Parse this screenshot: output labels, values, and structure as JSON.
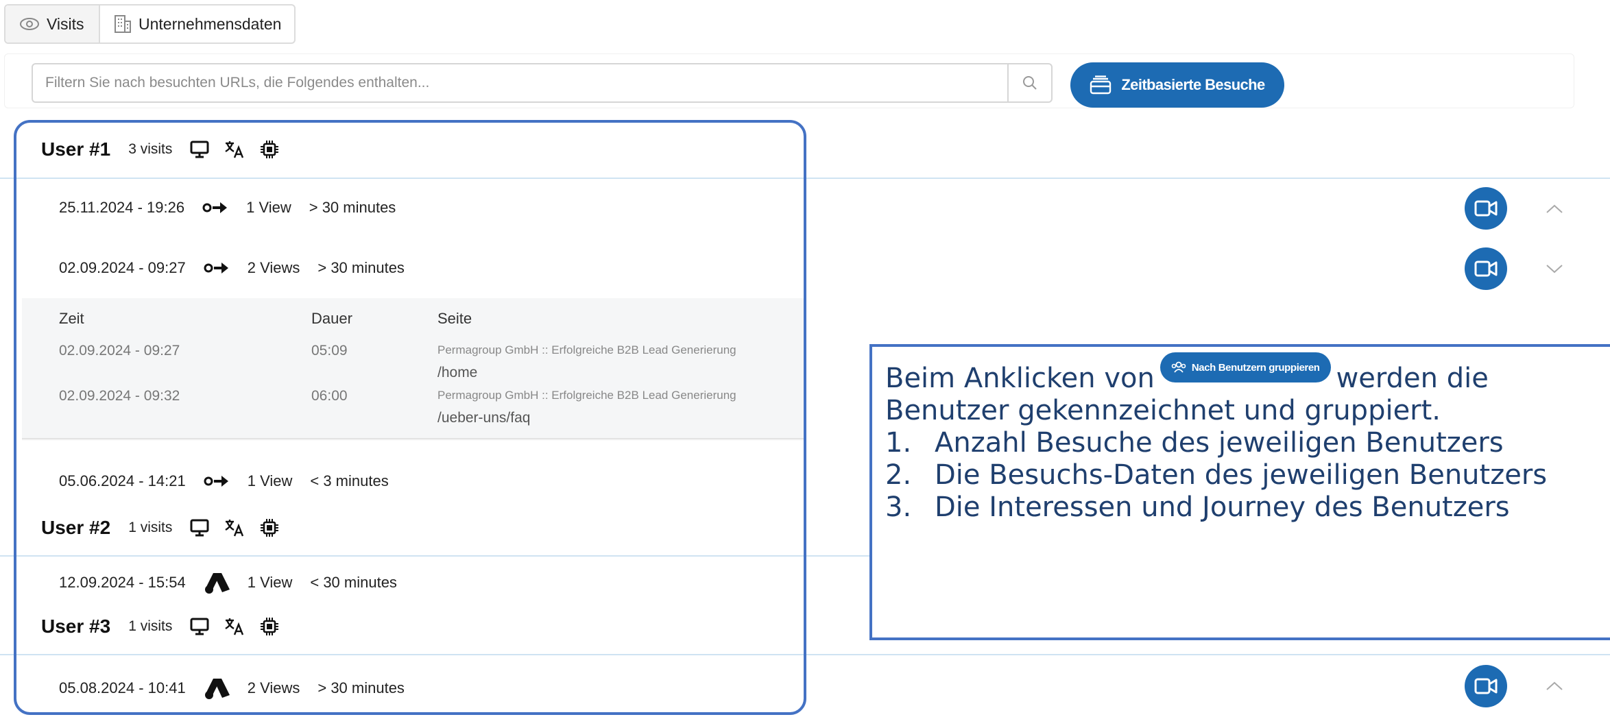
{
  "tabs": {
    "visits_label": "Visits",
    "company_label": "Unternehmensdaten"
  },
  "filter": {
    "placeholder": "Filtern Sie nach besuchten URLs, die Folgendes enthalten...",
    "time_based_label": "Zeitbasierte Besuche"
  },
  "users": [
    {
      "title": "User #1",
      "visits": "3 visits",
      "header_icons": [
        "monitor-icon",
        "translate-icon",
        "chip-icon"
      ],
      "sessions": [
        {
          "date": "25.11.2024 - 19:26",
          "source_icon": "direct-entry-icon",
          "views": "1 View",
          "duration": "> 30 minutes",
          "expanded": true
        },
        {
          "date": "02.09.2024 - 09:27",
          "source_icon": "direct-entry-icon",
          "views": "2 Views",
          "duration": "> 30 minutes",
          "expanded": false
        },
        {
          "date": "05.06.2024 - 14:21",
          "source_icon": "direct-entry-icon",
          "views": "1 View",
          "duration": "< 3 minutes"
        }
      ],
      "detail": {
        "headers": {
          "time": "Zeit",
          "duration": "Dauer",
          "page": "Seite"
        },
        "rows": [
          {
            "time": "02.09.2024 - 09:27",
            "duration": "05:09",
            "title": "Permagroup GmbH :: Erfolgreiche B2B Lead Generierung",
            "path": "/home"
          },
          {
            "time": "02.09.2024 - 09:32",
            "duration": "06:00",
            "title": "Permagroup GmbH :: Erfolgreiche B2B Lead Generierung",
            "path": "/ueber-uns/faq"
          }
        ]
      }
    },
    {
      "title": "User #2",
      "visits": "1 visits",
      "sessions": [
        {
          "date": "12.09.2024 - 15:54",
          "source_icon": "google-ads-icon",
          "views": "1 View",
          "duration": "< 30 minutes"
        }
      ]
    },
    {
      "title": "User #3",
      "visits": "1 visits",
      "sessions": [
        {
          "date": "05.08.2024 - 10:41",
          "source_icon": "google-ads-icon",
          "views": "2 Views",
          "duration": "> 30 minutes"
        }
      ]
    }
  ],
  "callout": {
    "intro_before": "Beim Anklicken von",
    "button_label": "Nach Benutzern gruppieren",
    "intro_after": "werden die",
    "intro_line2": "Benutzer gekennzeichnet und gruppiert.",
    "items": [
      {
        "num": "1.",
        "text": "Anzahl Besuche des jeweiligen Benutzers"
      },
      {
        "num": "2.",
        "text": "Die Besuchs-Daten des jeweiligen Benutzers"
      },
      {
        "num": "3.",
        "text": "Die Interessen und Journey des Benutzers"
      }
    ]
  },
  "colors": {
    "accent": "#1d6bb3",
    "annotation": "#4472c4",
    "callout_text": "#1f3f6e"
  }
}
